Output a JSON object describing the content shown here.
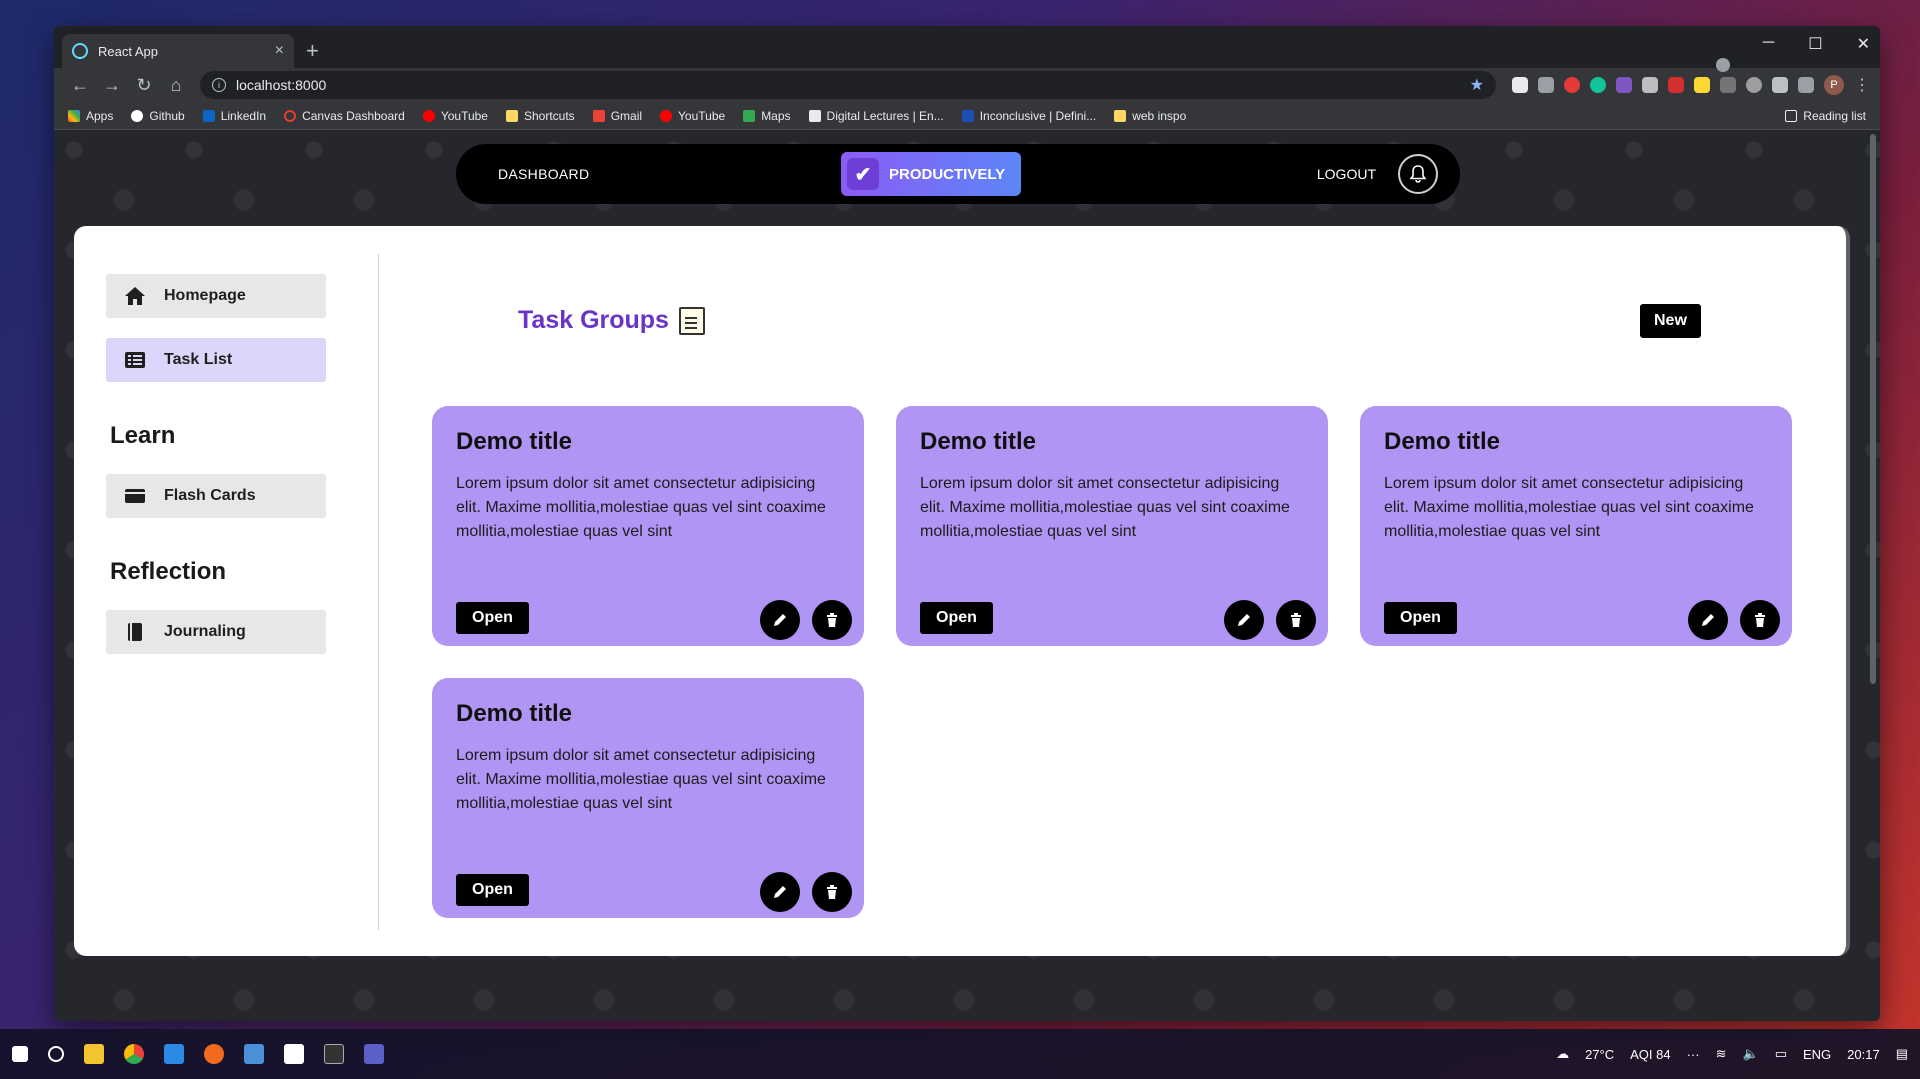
{
  "browser": {
    "tab_title": "React App",
    "url": "localhost:8000",
    "bookmarks": [
      "Apps",
      "Github",
      "LinkedIn",
      "Canvas Dashboard",
      "YouTube",
      "Shortcuts",
      "Gmail",
      "YouTube",
      "Maps",
      "Digital Lectures | En...",
      "Inconclusive | Defini...",
      "web inspo"
    ],
    "reading_list": "Reading list",
    "profile_initial": "P"
  },
  "navbar": {
    "dashboard": "DASHBOARD",
    "brand": "PRODUCTIVELY",
    "logout": "LOGOUT"
  },
  "sidebar": {
    "items": [
      {
        "label": "Homepage",
        "icon": "home-icon"
      },
      {
        "label": "Task List",
        "icon": "list-icon"
      }
    ],
    "learn_title": "Learn",
    "learn_items": [
      {
        "label": "Flash Cards",
        "icon": "card-icon"
      }
    ],
    "reflection_title": "Reflection",
    "reflection_items": [
      {
        "label": "Journaling",
        "icon": "book-icon"
      }
    ]
  },
  "main": {
    "title": "Task Groups",
    "new_button": "New",
    "cards": [
      {
        "title": "Demo title",
        "description": "Lorem ipsum dolor sit amet consectetur adipisicing elit. Maxime mollitia,molestiae quas vel sint coaxime mollitia,molestiae quas vel sint",
        "open_label": "Open"
      },
      {
        "title": "Demo title",
        "description": "Lorem ipsum dolor sit amet consectetur adipisicing elit. Maxime mollitia,molestiae quas vel sint coaxime mollitia,molestiae quas vel sint",
        "open_label": "Open"
      },
      {
        "title": "Demo title",
        "description": "Lorem ipsum dolor sit amet consectetur adipisicing elit. Maxime mollitia,molestiae quas vel sint coaxime mollitia,molestiae quas vel sint",
        "open_label": "Open"
      },
      {
        "title": "Demo title",
        "description": "Lorem ipsum dolor sit amet consectetur adipisicing elit. Maxime mollitia,molestiae quas vel sint coaxime mollitia,molestiae quas vel sint",
        "open_label": "Open"
      }
    ]
  },
  "taskbar": {
    "weather": "27°C",
    "aqi": "AQI 84",
    "lang": "ENG",
    "time": "20:17"
  },
  "colors": {
    "accent": "#6a34c6",
    "card_bg": "#b195f4",
    "active_item": "#ddd6fb"
  }
}
